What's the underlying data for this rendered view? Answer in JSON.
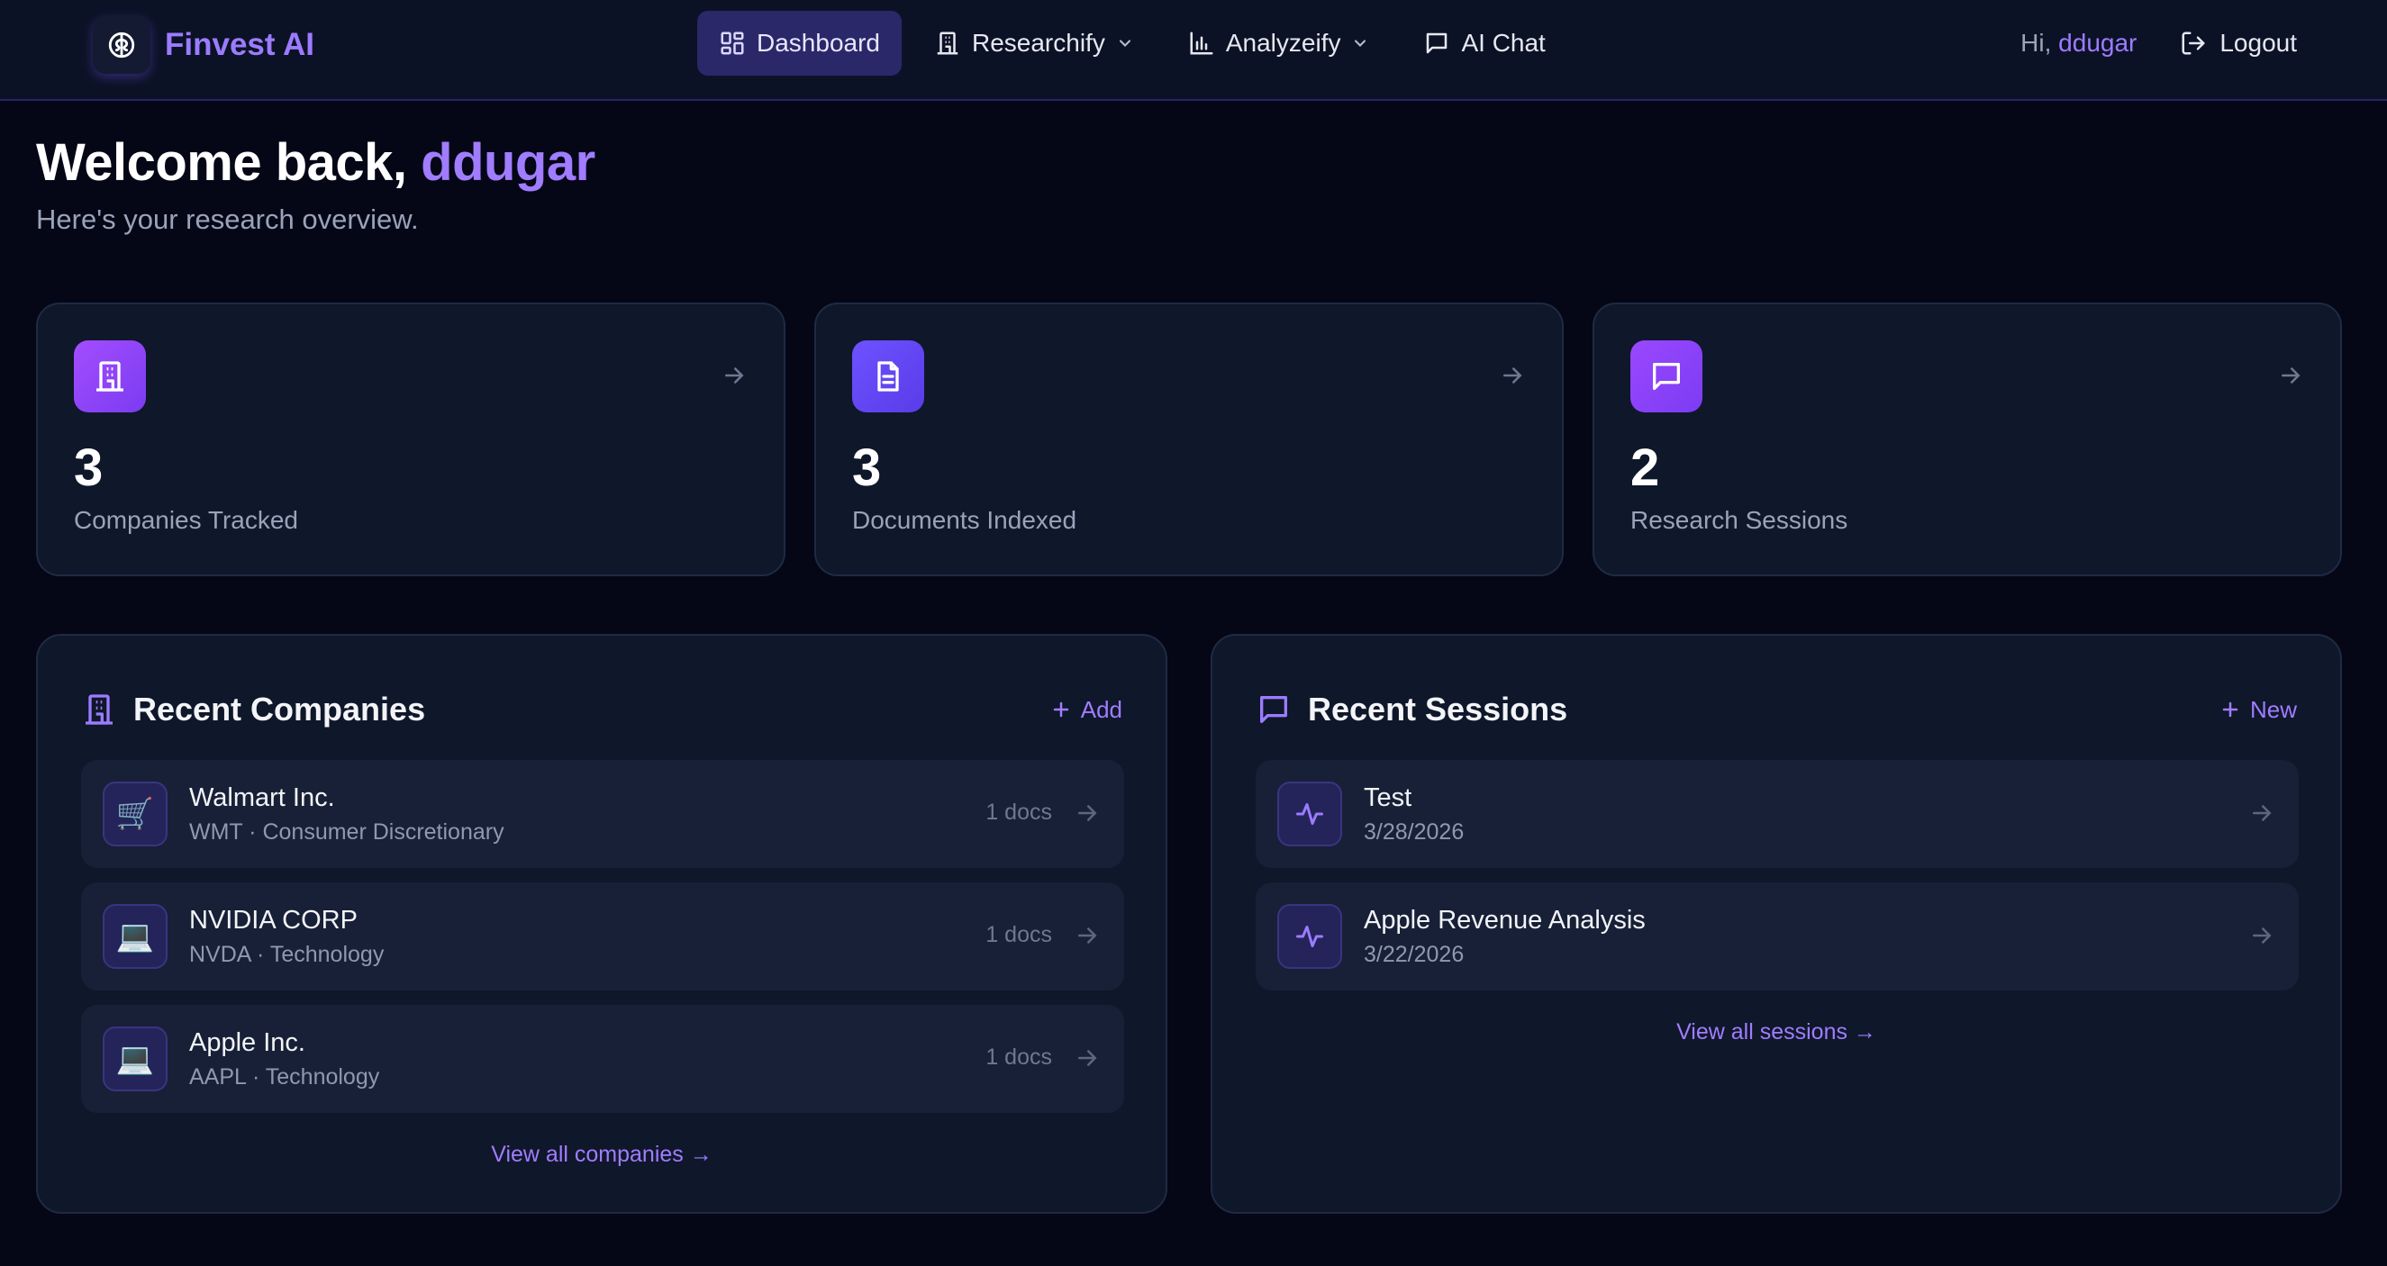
{
  "brand": {
    "name": "Finvest AI",
    "icon": "brain-icon"
  },
  "nav": {
    "items": [
      {
        "label": "Dashboard",
        "icon": "dashboard-icon"
      },
      {
        "label": "Researchify",
        "icon": "building-icon"
      },
      {
        "label": "Analyzeify",
        "icon": "bar-chart-icon"
      },
      {
        "label": "AI Chat",
        "icon": "chat-icon"
      }
    ],
    "greeting": "Hi,",
    "username": "ddugar",
    "logout": "Logout"
  },
  "welcome": {
    "title": "Welcome back,",
    "name": "ddugar",
    "subtitle": "Here's your research overview."
  },
  "stats": [
    {
      "value": "3",
      "label": "Companies Tracked",
      "icon": "building-icon",
      "color": "#9b4dff"
    },
    {
      "value": "3",
      "label": "Documents Indexed",
      "icon": "document-icon",
      "color": "#6a4cff"
    },
    {
      "value": "2",
      "label": "Research Sessions",
      "icon": "chat-icon",
      "color": "#8a46ff"
    }
  ],
  "companies": {
    "title": "Recent Companies",
    "action": "Add",
    "items": [
      {
        "name": "Walmart Inc.",
        "sub": "WMT · Consumer Discretionary",
        "docs": "1 docs",
        "emoji": "🛒"
      },
      {
        "name": "NVIDIA CORP",
        "sub": "NVDA · Technology",
        "docs": "1 docs",
        "emoji": "💻"
      },
      {
        "name": "Apple Inc.",
        "sub": "AAPL · Technology",
        "docs": "1 docs",
        "emoji": "💻"
      }
    ],
    "view_all": "View all companies →"
  },
  "sessions": {
    "title": "Recent Sessions",
    "action": "New",
    "items": [
      {
        "name": "Test",
        "date": "3/28/2026"
      },
      {
        "name": "Apple Revenue Analysis",
        "date": "3/22/2026"
      }
    ],
    "view_all": "View all sessions →"
  }
}
